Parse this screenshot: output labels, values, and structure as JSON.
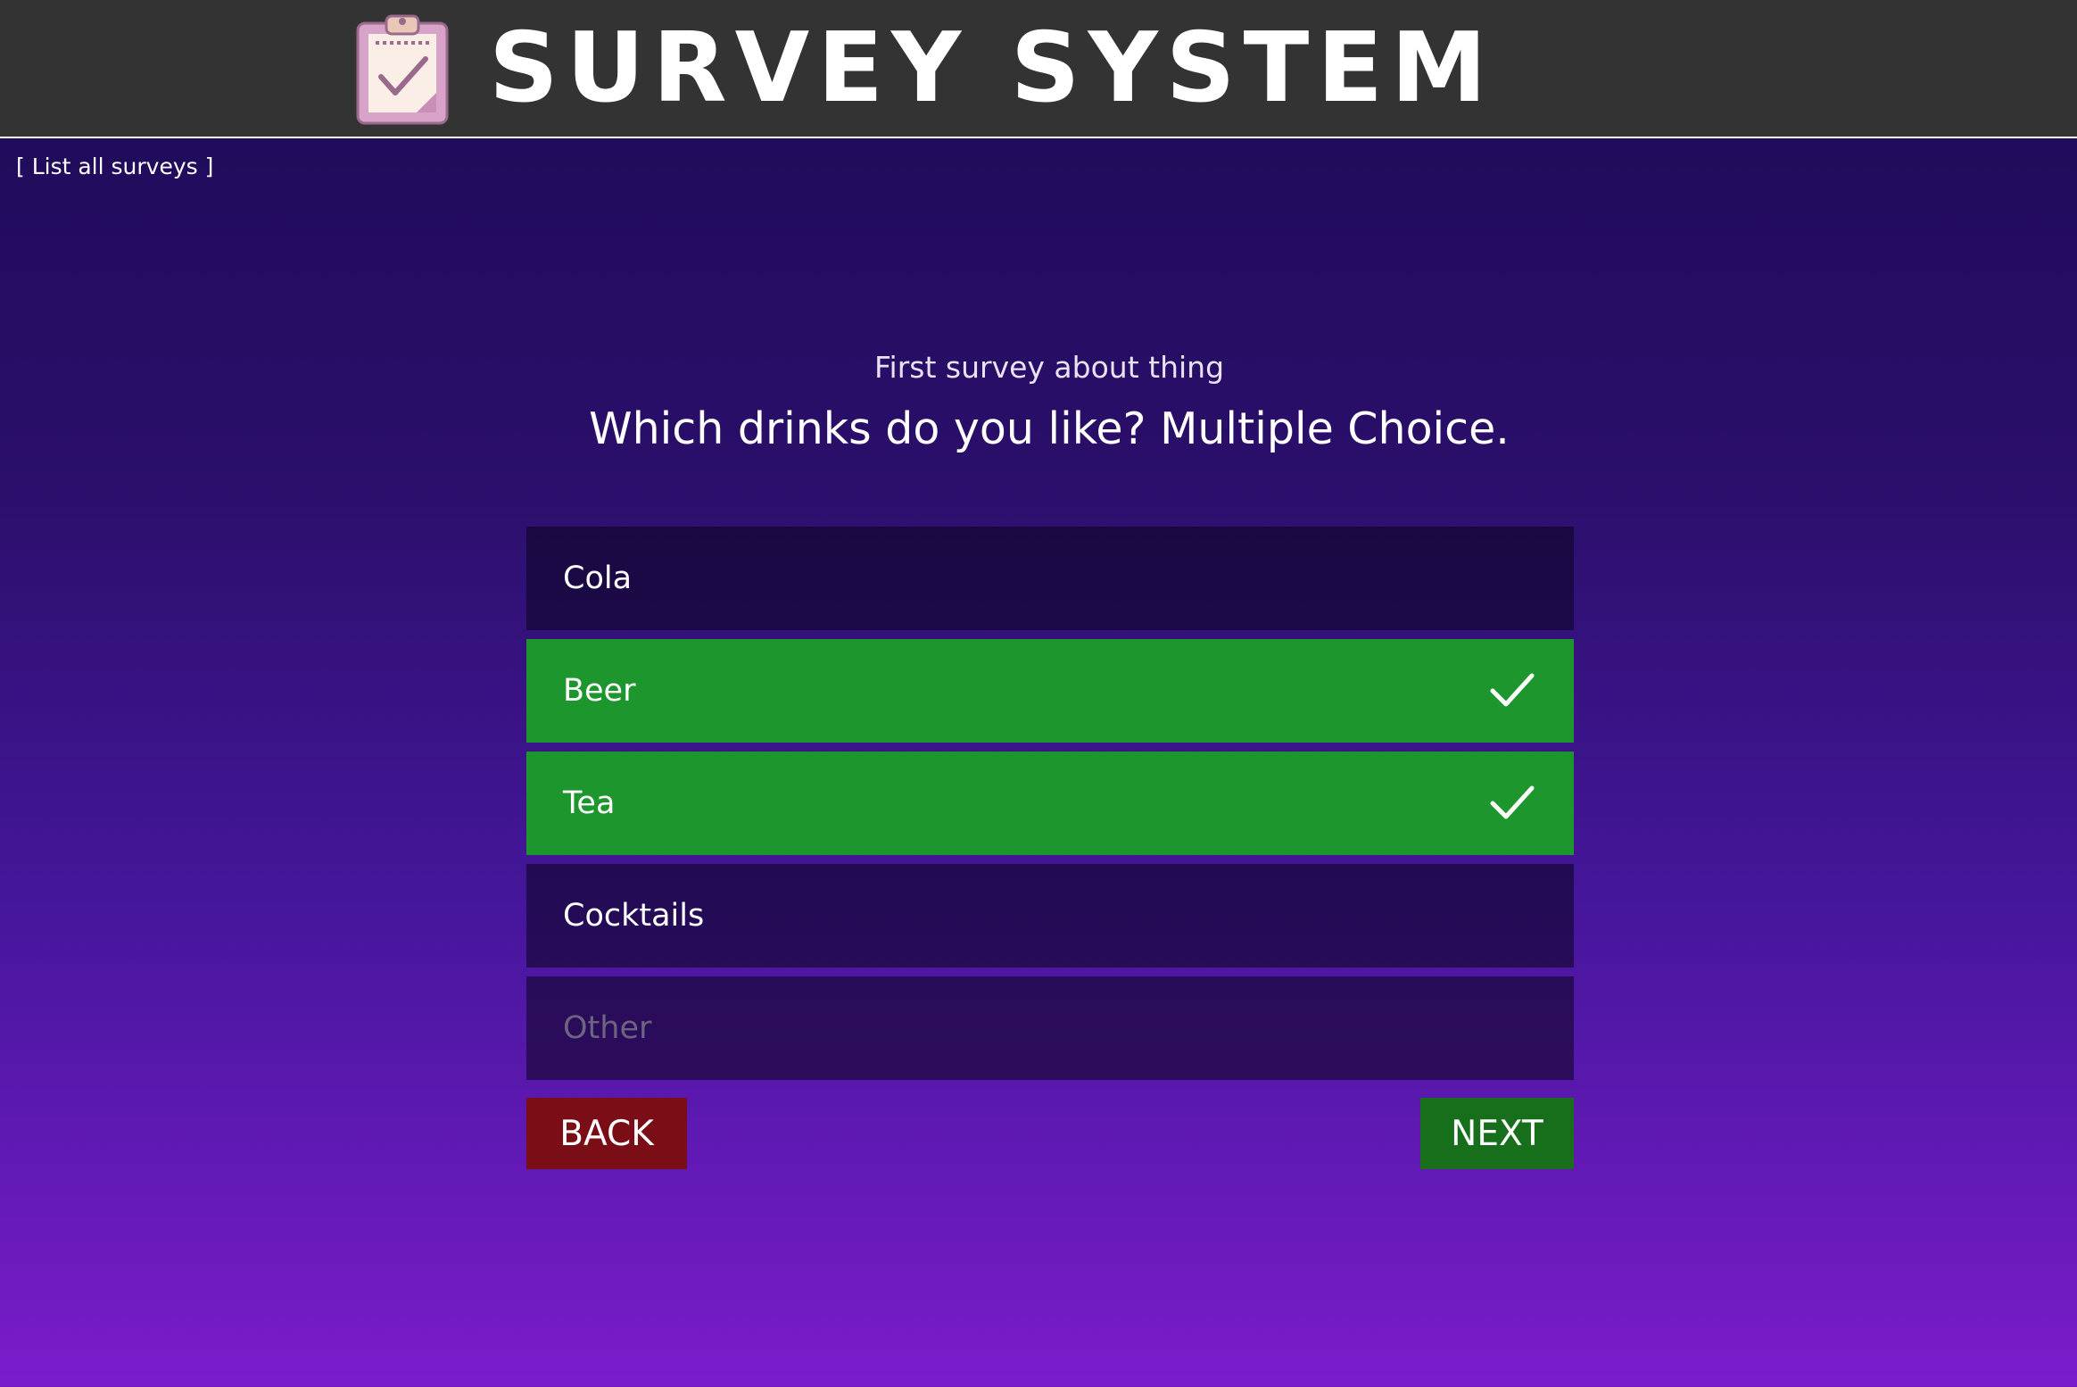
{
  "header": {
    "title": "SURVEY SYSTEM",
    "logo_icon": "clipboard-check-icon"
  },
  "nav": {
    "list_link": "[ List all surveys ]"
  },
  "survey": {
    "title": "First survey about thing",
    "question": "Which drinks do you like? Multiple Choice."
  },
  "options": [
    {
      "label": "Cola",
      "selected": false
    },
    {
      "label": "Beer",
      "selected": true
    },
    {
      "label": "Tea",
      "selected": true
    },
    {
      "label": "Cocktails",
      "selected": false
    }
  ],
  "other": {
    "placeholder": "Other",
    "value": ""
  },
  "buttons": {
    "back": "BACK",
    "next": "NEXT"
  },
  "colors": {
    "header_bg": "#333333",
    "selected_option": "#1e962e",
    "back_button": "#7a0d16",
    "next_button": "#176e1b",
    "gradient_top": "#1c0a55",
    "gradient_bottom": "#7a1ccb"
  }
}
